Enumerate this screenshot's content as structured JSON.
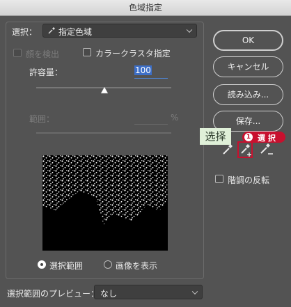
{
  "window": {
    "title": "色域指定"
  },
  "select": {
    "label": "選択：",
    "value": "指定色域"
  },
  "detect_faces": {
    "label": "顔を検出",
    "checked": false,
    "enabled": false
  },
  "localized_clusters": {
    "label": "カラークラスタ指定",
    "checked": false
  },
  "fuzziness": {
    "label": "許容量：",
    "value": "100"
  },
  "range": {
    "label": "範囲：",
    "value": "",
    "unit": "%"
  },
  "buttons": {
    "ok": "OK",
    "cancel": "キャンセル",
    "load": "読み込み...",
    "save": "保存..."
  },
  "callout": {
    "tooltip": "选择",
    "badge_number": "1",
    "badge_text": "選 択"
  },
  "tools": [
    "eyedropper-icon",
    "eyedropper-add-icon",
    "eyedropper-subtract-icon"
  ],
  "invert": {
    "label": "階調の反転",
    "checked": false
  },
  "view": {
    "selection_label": "選択範囲",
    "image_label": "画像を表示",
    "selected": "selection"
  },
  "preview": {
    "label": "選択範囲のプレビュー：",
    "value": "なし"
  },
  "colors": {
    "accent_red": "#c8102e",
    "tooltip_green": "#dff0d8",
    "preview_bg": "#000000",
    "dialog_bg": "#535353"
  }
}
